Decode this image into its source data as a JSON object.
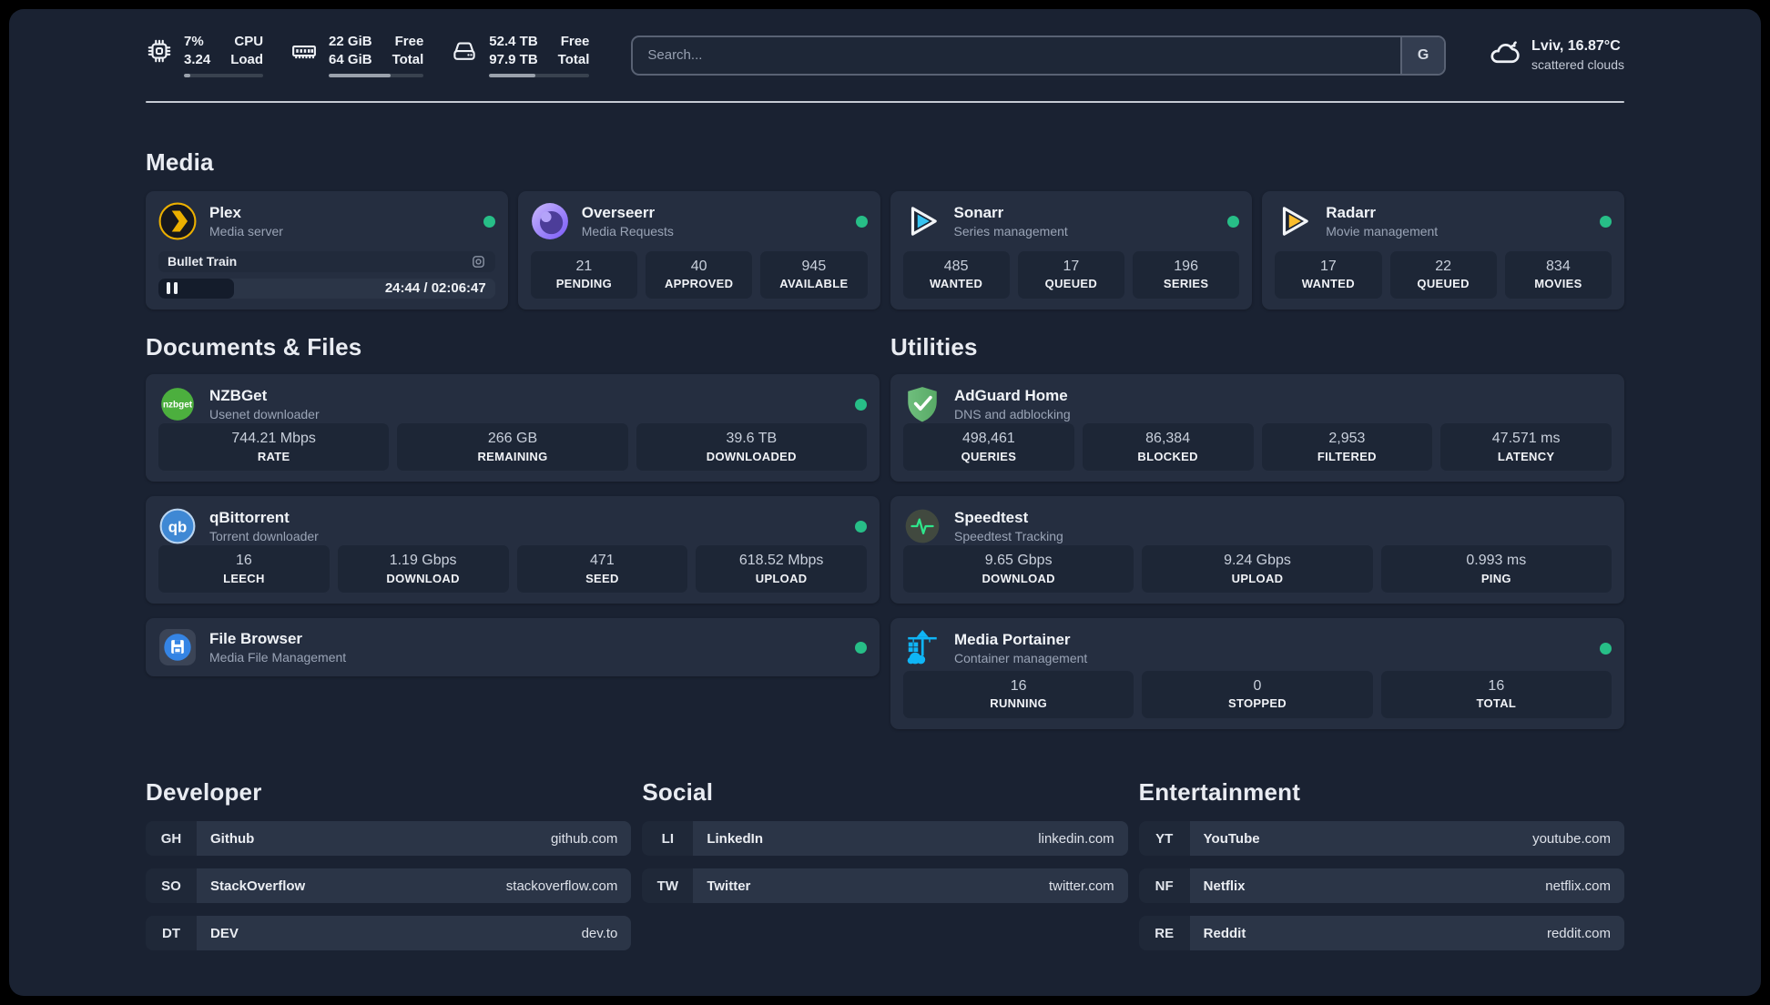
{
  "topbar": {
    "cpu": {
      "icon": "cpu-icon",
      "values": [
        "7%",
        "3.24"
      ],
      "labels": [
        "CPU",
        "Load"
      ],
      "progress": 8
    },
    "ram": {
      "icon": "memory-icon",
      "values": [
        "22 GiB",
        "64 GiB"
      ],
      "labels": [
        "Free",
        "Total"
      ],
      "progress": 65
    },
    "disk": {
      "icon": "disk-icon",
      "values": [
        "52.4 TB",
        "97.9 TB"
      ],
      "labels": [
        "Free",
        "Total"
      ],
      "progress": 46
    },
    "search": {
      "placeholder": "Search...",
      "engine_label": "G"
    },
    "weather": {
      "icon": "cloud-icon",
      "location": "Lviv, 16.87°C",
      "condition": "scattered clouds"
    }
  },
  "sections": {
    "media": {
      "title": "Media",
      "plex": {
        "icon": "plex-icon",
        "name": "Plex",
        "desc": "Media server",
        "online": true,
        "now_playing": "Bullet Train",
        "time": "24:44 / 02:06:47",
        "progress_percent": 20
      },
      "overseerr": {
        "icon": "overseerr-icon",
        "name": "Overseerr",
        "desc": "Media Requests",
        "online": true,
        "stats": [
          {
            "value": "21",
            "label": "PENDING"
          },
          {
            "value": "40",
            "label": "APPROVED"
          },
          {
            "value": "945",
            "label": "AVAILABLE"
          }
        ]
      },
      "sonarr": {
        "icon": "sonarr-icon",
        "name": "Sonarr",
        "desc": "Series management",
        "online": true,
        "stats": [
          {
            "value": "485",
            "label": "WANTED"
          },
          {
            "value": "17",
            "label": "QUEUED"
          },
          {
            "value": "196",
            "label": "SERIES"
          }
        ]
      },
      "radarr": {
        "icon": "radarr-icon",
        "name": "Radarr",
        "desc": "Movie management",
        "online": true,
        "stats": [
          {
            "value": "17",
            "label": "WANTED"
          },
          {
            "value": "22",
            "label": "QUEUED"
          },
          {
            "value": "834",
            "label": "MOVIES"
          }
        ]
      }
    },
    "documents": {
      "title": "Documents & Files",
      "nzbget": {
        "icon": "nzbget-icon",
        "name": "NZBGet",
        "desc": "Usenet downloader",
        "online": true,
        "stats": [
          {
            "value": "744.21 Mbps",
            "label": "RATE"
          },
          {
            "value": "266 GB",
            "label": "REMAINING"
          },
          {
            "value": "39.6 TB",
            "label": "DOWNLOADED"
          }
        ]
      },
      "qbittorrent": {
        "icon": "qbittorrent-icon",
        "name": "qBittorrent",
        "desc": "Torrent downloader",
        "online": true,
        "stats": [
          {
            "value": "16",
            "label": "LEECH"
          },
          {
            "value": "1.19 Gbps",
            "label": "DOWNLOAD"
          },
          {
            "value": "471",
            "label": "SEED"
          },
          {
            "value": "618.52 Mbps",
            "label": "UPLOAD"
          }
        ]
      },
      "filebrowser": {
        "icon": "filebrowser-icon",
        "name": "File Browser",
        "desc": "Media File Management",
        "online": true
      }
    },
    "utilities": {
      "title": "Utilities",
      "adguard": {
        "icon": "adguard-icon",
        "name": "AdGuard Home",
        "desc": "DNS and adblocking",
        "online": false,
        "stats": [
          {
            "value": "498,461",
            "label": "QUERIES"
          },
          {
            "value": "86,384",
            "label": "BLOCKED"
          },
          {
            "value": "2,953",
            "label": "FILTERED"
          },
          {
            "value": "47.571 ms",
            "label": "LATENCY"
          }
        ]
      },
      "speedtest": {
        "icon": "speedtest-icon",
        "name": "Speedtest",
        "desc": "Speedtest Tracking",
        "online": false,
        "stats": [
          {
            "value": "9.65 Gbps",
            "label": "DOWNLOAD"
          },
          {
            "value": "9.24 Gbps",
            "label": "UPLOAD"
          },
          {
            "value": "0.993 ms",
            "label": "PING"
          }
        ]
      },
      "portainer": {
        "icon": "portainer-icon",
        "name": "Media Portainer",
        "desc": "Container management",
        "online": true,
        "stats": [
          {
            "value": "16",
            "label": "RUNNING"
          },
          {
            "value": "0",
            "label": "STOPPED"
          },
          {
            "value": "16",
            "label": "TOTAL"
          }
        ]
      }
    },
    "developer": {
      "title": "Developer",
      "links": [
        {
          "abbr": "GH",
          "name": "Github",
          "url": "github.com"
        },
        {
          "abbr": "SO",
          "name": "StackOverflow",
          "url": "stackoverflow.com"
        },
        {
          "abbr": "DT",
          "name": "DEV",
          "url": "dev.to"
        }
      ]
    },
    "social": {
      "title": "Social",
      "links": [
        {
          "abbr": "LI",
          "name": "LinkedIn",
          "url": "linkedin.com"
        },
        {
          "abbr": "TW",
          "name": "Twitter",
          "url": "twitter.com"
        }
      ]
    },
    "entertainment": {
      "title": "Entertainment",
      "links": [
        {
          "abbr": "YT",
          "name": "YouTube",
          "url": "youtube.com"
        },
        {
          "abbr": "NF",
          "name": "Netflix",
          "url": "netflix.com"
        },
        {
          "abbr": "RE",
          "name": "Reddit",
          "url": "reddit.com"
        }
      ]
    }
  },
  "colors": {
    "background": "#1a2232",
    "card": "#252e40",
    "tile": "#1d2636",
    "status_online": "#27be87",
    "plex_gold": "#ebaf00",
    "sonarr_cyan": "#36c3f1",
    "radarr_yellow": "#fcbe2d",
    "portainer_blue": "#0fb5f6",
    "speedtest_green": "#2fe58c"
  }
}
